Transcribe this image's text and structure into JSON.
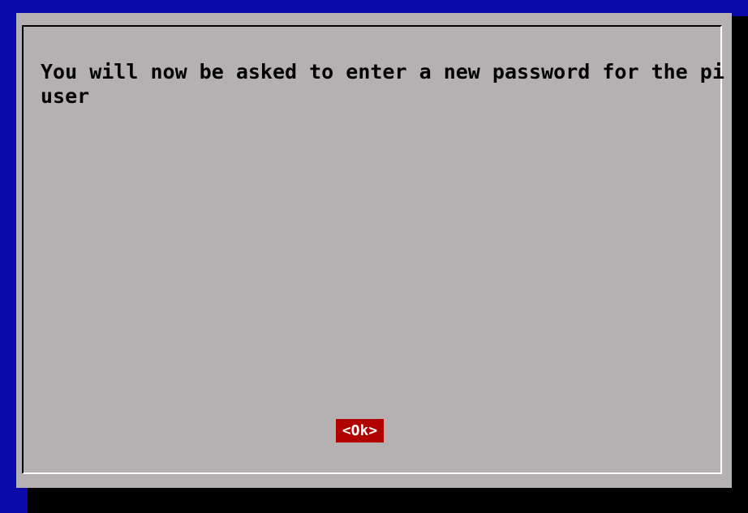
{
  "dialog": {
    "message_lines": [
      "You will now be asked to enter a new password for the pi",
      "user"
    ],
    "ok_button_label": "<Ok>"
  },
  "colors": {
    "background": "#0a0aa8",
    "dialog": "#b5b1b3",
    "shadow": "#000000",
    "button_selected": "#b00000",
    "button_text": "#ffffff"
  }
}
